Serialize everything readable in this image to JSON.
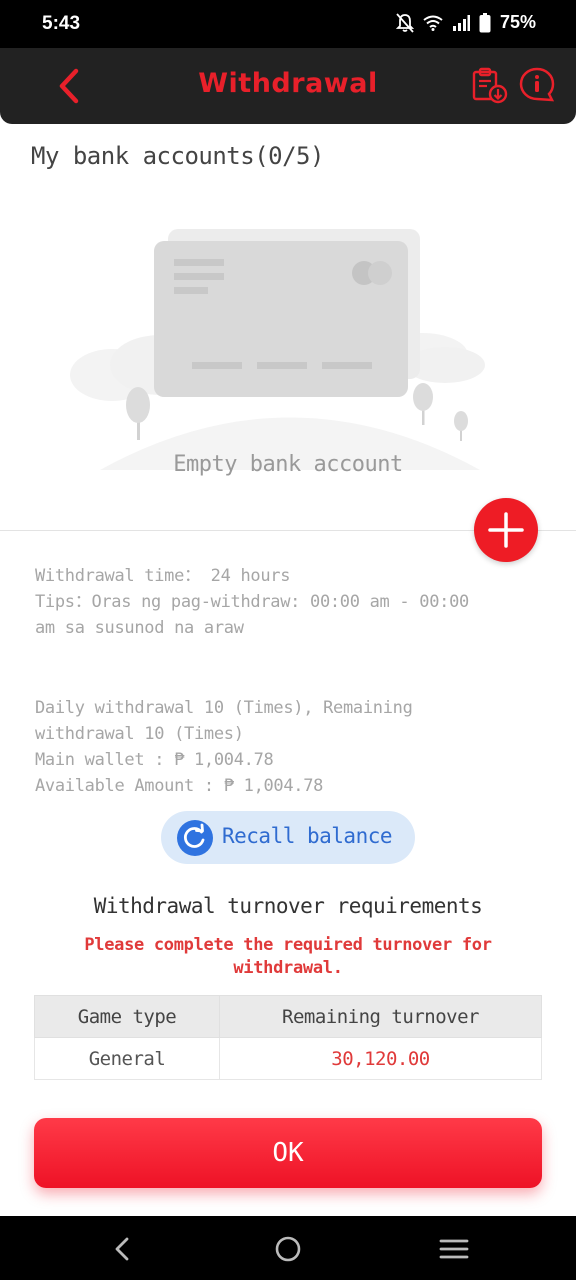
{
  "status_bar": {
    "time": "5:43",
    "battery": "75%",
    "icons": [
      "bell-off-icon",
      "wifi-icon",
      "signal-icon",
      "battery-icon"
    ]
  },
  "header": {
    "title": "Withdrawal",
    "accent_color": "#e8202a",
    "icons": [
      "back-arrow-icon",
      "clipboard-download-icon",
      "info-chat-icon"
    ]
  },
  "bank_accounts": {
    "title": "My bank accounts(0/5)",
    "empty_text": "Empty bank account",
    "add_icon": "plus-icon"
  },
  "info": {
    "withdrawal_time": "Withdrawal time：  24 hours",
    "tips_line1": "Tips：Oras ng pag-withdraw: 00:00 am - 00:00",
    "tips_line2": "am sa susunod na araw",
    "daily_line1": "Daily withdrawal 10 (Times), Remaining",
    "daily_line2": "withdrawal 10 (Times)",
    "main_wallet": "Main wallet : ₱ 1,004.78",
    "available_amount": "Available Amount : ₱ 1,004.78"
  },
  "recall": {
    "label": "Recall balance",
    "icon": "refresh-icon"
  },
  "turnover": {
    "title": "Withdrawal turnover requirements",
    "warning_line1": "Please complete the required turnover for",
    "warning_line2": "withdrawal.",
    "columns": [
      "Game type",
      "Remaining turnover"
    ],
    "rows": [
      {
        "game_type": "General",
        "remaining": "30,120.00"
      }
    ]
  },
  "ok_label": "OK",
  "nav": {
    "icons": [
      "nav-back-icon",
      "nav-home-icon",
      "nav-recents-icon"
    ]
  }
}
